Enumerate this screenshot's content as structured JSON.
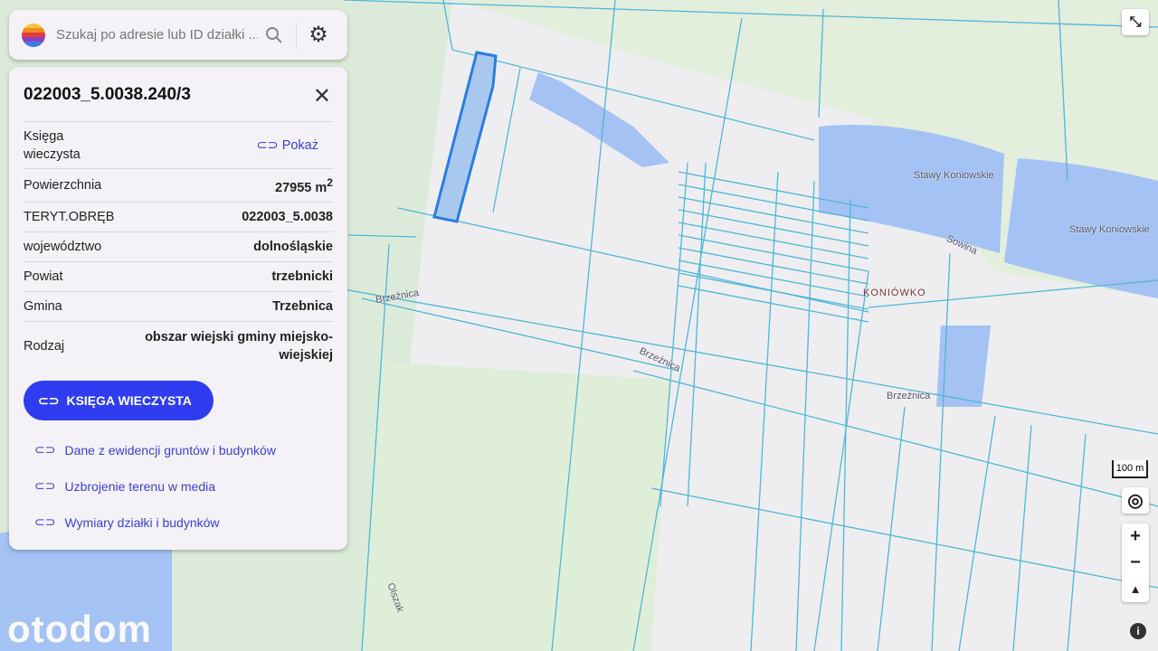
{
  "search": {
    "placeholder": "Szukaj po adresie lub ID działki ..."
  },
  "parcel": {
    "id": "022003_5.0038.240/3",
    "rows": [
      {
        "label": "Księga wieczysta",
        "value": "Pokaż"
      },
      {
        "label": "Powierzchnia",
        "value": "27955 m",
        "sup": "2"
      },
      {
        "label": "TERYT.OBRĘB",
        "value": "022003_5.0038"
      },
      {
        "label": "województwo",
        "value": "dolnośląskie"
      },
      {
        "label": "Powiat",
        "value": "trzebnicki"
      },
      {
        "label": "Gmina",
        "value": "Trzebnica"
      },
      {
        "label": "Rodzaj",
        "value": "obszar wiejski gminy miejsko-wiejskiej"
      }
    ],
    "button": "KSIĘGA WIECZYSTA",
    "links": [
      "Dane z ewidencji gruntów i budynków",
      "Uzbrojenie terenu w media",
      "Wymiary działki i budynków"
    ]
  },
  "map": {
    "labels": [
      "Stawy Koniowskie",
      "Stawy Koniowskie",
      "Sowina",
      "KONIÓWKO",
      "Brzeźnica",
      "Brzeźnica",
      "Brzeźnica",
      "Olszak"
    ],
    "scale": "100 m"
  },
  "brand": "otodom",
  "colors": {
    "parcel_line": "#4fb6d8",
    "highlight": "#2a7de1",
    "water": "#a4c2f4",
    "accent": "#2f3cf0"
  }
}
